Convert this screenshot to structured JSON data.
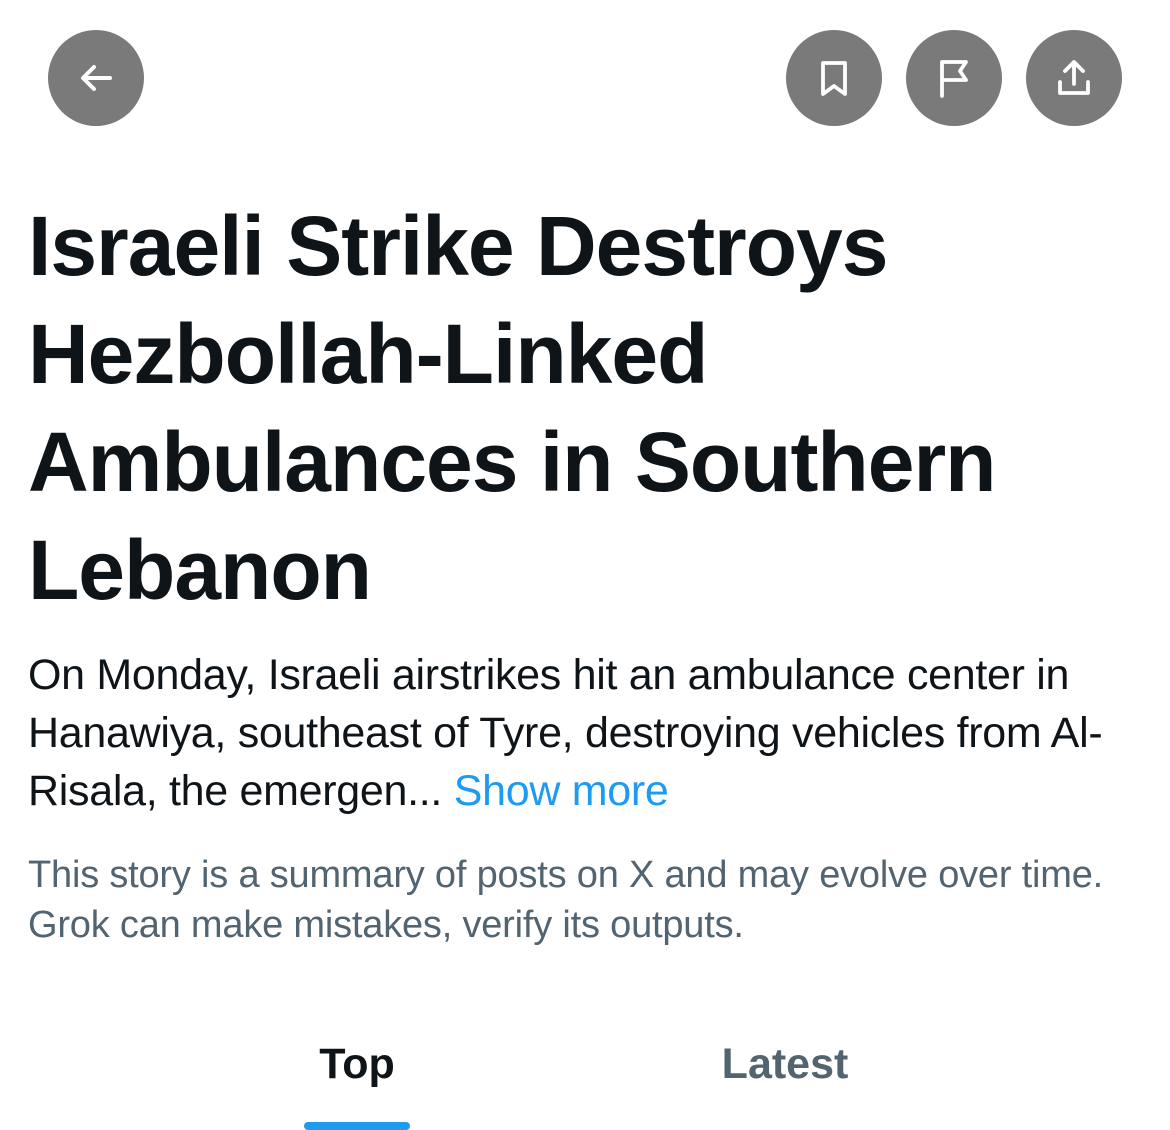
{
  "toolbar": {
    "back_icon": "arrow-left-icon",
    "bookmark_icon": "bookmark-icon",
    "flag_icon": "flag-icon",
    "share_icon": "share-icon",
    "button_color": "#7a7a7a"
  },
  "story": {
    "title": "Israeli Strike Destroys Hezbollah-Linked Ambulances in Southern Lebanon",
    "summary": "On Monday, Israeli airstrikes hit an ambulance center in Hanawiya, southeast of Tyre, destroying vehicles from Al-Risala, the emergen...",
    "show_more_label": "Show more",
    "disclaimer": "This story is a summary of posts on X and may evolve over time. Grok can make mistakes, verify its outputs."
  },
  "tabs": [
    {
      "label": "Top",
      "selected": true
    },
    {
      "label": "Latest",
      "selected": false
    }
  ],
  "colors": {
    "text": "#0f1419",
    "secondary_text": "#536471",
    "accent": "#1d9bf0"
  }
}
